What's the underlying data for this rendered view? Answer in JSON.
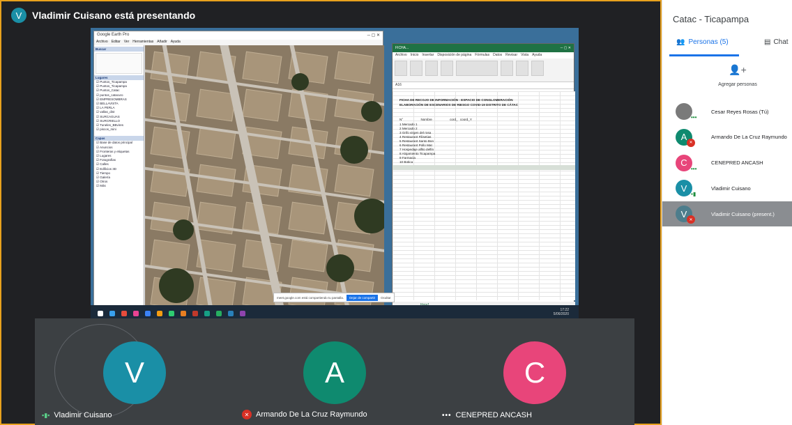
{
  "presenter": {
    "initial": "V",
    "label": "Vladimir Cuisano está presentando",
    "avatar_color": "#1a8fa6"
  },
  "shared_screen": {
    "earth": {
      "title": "Google Earth Pro",
      "menu": [
        "Archivo",
        "Editar",
        "Ver",
        "Herramientas",
        "Añadir",
        "Ayuda"
      ],
      "search_section": "Buscar",
      "places_section": "Lugares",
      "places": [
        "Puntos_Ticapampa",
        "Puntos_Ticapampa",
        "Puntos_Catac",
        "puntos_catacuro",
        "EMPRESOMBRAS",
        "BELLAVISTA",
        "LA PERLA",
        "vallas_dist",
        "SURCAGUAS",
        "SURCRIELLO",
        "Tuneles_BBvires",
        "piscos_mini"
      ],
      "layers_section": "Capas",
      "layers": [
        "Base de datos principal",
        "Anuncios",
        "Fronteras y etiquetas",
        "Lugares",
        "Fotografías",
        "Calles",
        "Edificios 3D",
        "Tiempo",
        "Galería",
        "Otros",
        "Más"
      ]
    },
    "excel": {
      "title": "FICHA...",
      "menu": [
        "Archivo",
        "Inicio",
        "Insertar",
        "Disposición de página",
        "Fórmulas",
        "Datos",
        "Revisar",
        "Vista",
        "Ayuda"
      ],
      "cell_ref": "A16",
      "title_row1": "FICHA DE RECOJO DE INFORMACIÓN - ESPACIO DE CONGLOMERACIÓN",
      "title_row2": "ELABORACIÓN DE ESCENARIOS DE RIESGO COVID-19 DISTRITO DE CÁTAC",
      "headers": [
        "N°",
        "Nombre",
        "cord_",
        "coord_Y"
      ],
      "rows": [
        "1 Mercado 1",
        "2 Mercado 2",
        "3 Grifo virgen del rosa",
        "4 Restaurant Filisetias",
        "5 Restaurant Santo Bon",
        "6 Restaurant Pollo Mat",
        "7 Hospedaje alfito delfin",
        "8 Alojamiento Ticapampa",
        "9 Farmacia",
        "10 Botica"
      ],
      "sheet_tab": "Hoja1"
    },
    "share_notice": "meet.google.com está compartiendo tu pantalla.",
    "share_stop": "Dejar de compartir",
    "share_hide": "Ocultar",
    "clock": "17:22",
    "date": "5/06/2020"
  },
  "tiles": [
    {
      "initial": "V",
      "name": "Vladimir Cuisano",
      "color": "#1a8fa6",
      "status": "speaking"
    },
    {
      "initial": "A",
      "name": "Armando De La Cruz Raymundo",
      "color": "#0f8a6f",
      "status": "muted"
    },
    {
      "initial": "C",
      "name": "CENEPRED ANCASH",
      "color": "#e8457a",
      "status": "dots"
    }
  ],
  "panel": {
    "meeting_title": "Catac - Ticapampa",
    "tab_people": "Personas (5)",
    "tab_chat": "Chat",
    "add_people": "Agregar personas",
    "people": [
      {
        "initial": "",
        "name": "Cesar Reyes Rosas (Tú)",
        "color": "#7a7a7a",
        "status": "dots",
        "selected": false,
        "photo": true
      },
      {
        "initial": "A",
        "name": "Armando De La Cruz Raymundo",
        "color": "#0f8a6f",
        "status": "muted",
        "selected": false
      },
      {
        "initial": "C",
        "name": "CENEPRED ANCASH",
        "color": "#e8457a",
        "status": "dots",
        "selected": false
      },
      {
        "initial": "V",
        "name": "Vladimir Cuisano",
        "color": "#1a8fa6",
        "status": "speaking",
        "selected": false
      },
      {
        "initial": "V",
        "name": "Vladimir Cuisano (present.)",
        "color": "#4d7d8c",
        "status": "presenting",
        "selected": true
      }
    ]
  }
}
